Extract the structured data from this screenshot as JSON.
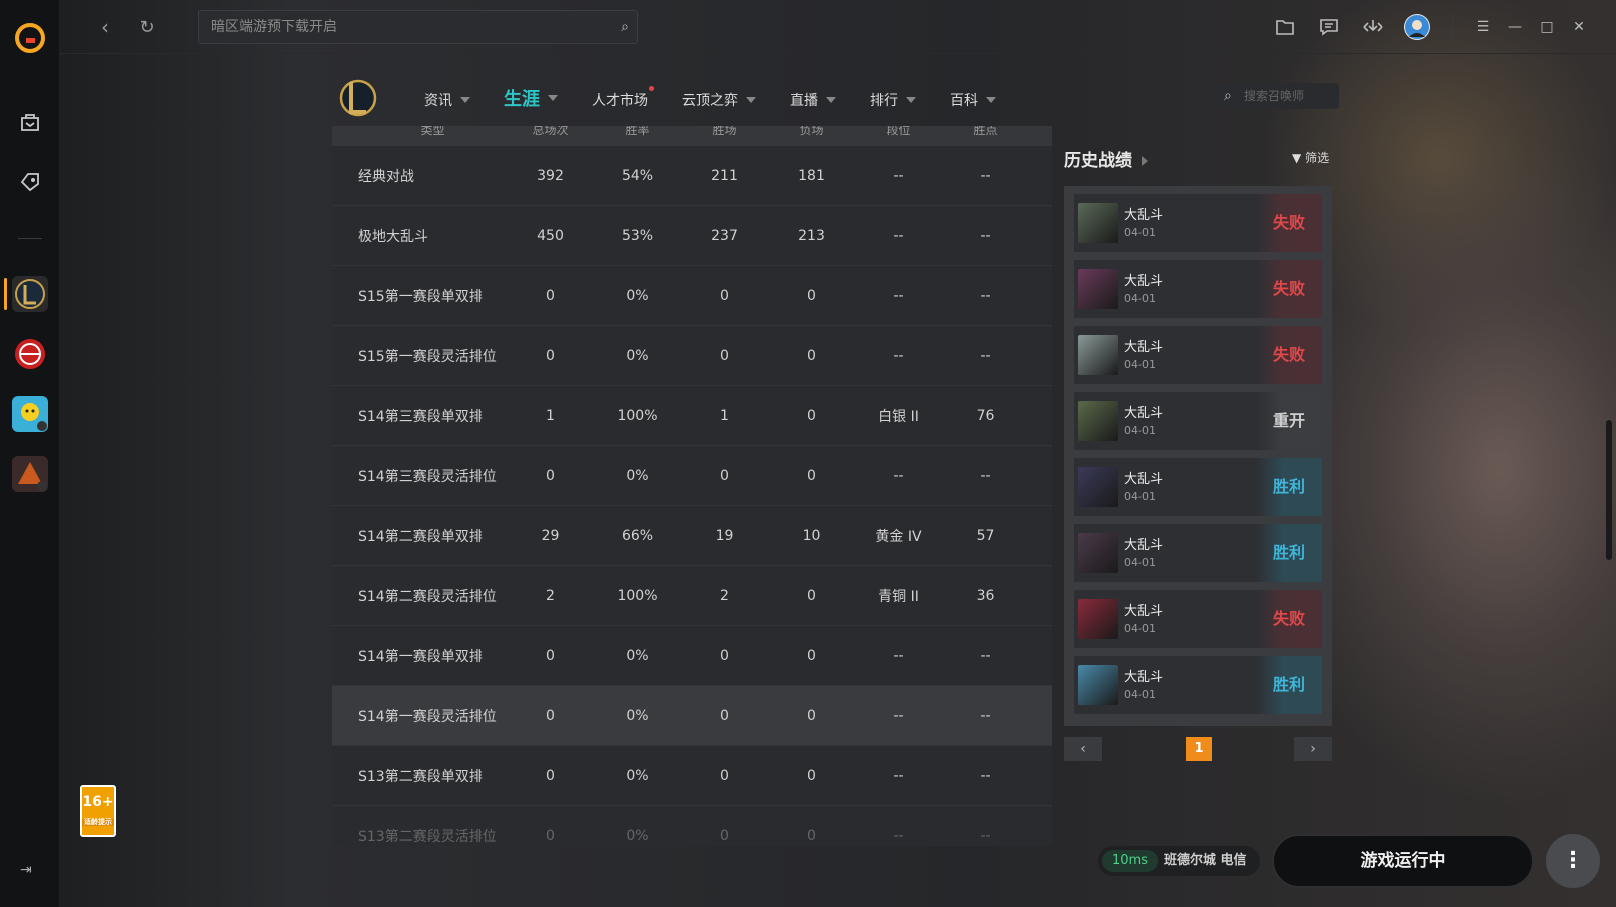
{
  "topbar": {
    "search_placeholder": "暗区端游预下载开启"
  },
  "subnav": {
    "tabs": [
      {
        "label": "资讯",
        "caret": true
      },
      {
        "label": "生涯",
        "caret": true,
        "active": true
      },
      {
        "label": "人才市场",
        "dot": true
      },
      {
        "label": "云顶之弈",
        "caret": true
      },
      {
        "label": "直播",
        "caret": true
      },
      {
        "label": "排行",
        "caret": true
      },
      {
        "label": "百科",
        "caret": true
      }
    ],
    "summoner_search_placeholder": "搜索召唤师"
  },
  "stats_table": {
    "headers": [
      "类型",
      "总场次",
      "胜率",
      "胜场",
      "负场",
      "段位",
      "胜点"
    ],
    "rows": [
      [
        "经典对战",
        "392",
        "54%",
        "211",
        "181",
        "--",
        "--"
      ],
      [
        "极地大乱斗",
        "450",
        "53%",
        "237",
        "213",
        "--",
        "--"
      ],
      [
        "S15第一赛段单双排",
        "0",
        "0%",
        "0",
        "0",
        "--",
        "--"
      ],
      [
        "S15第一赛段灵活排位",
        "0",
        "0%",
        "0",
        "0",
        "--",
        "--"
      ],
      [
        "S14第三赛段单双排",
        "1",
        "100%",
        "1",
        "0",
        "白银 II",
        "76"
      ],
      [
        "S14第三赛段灵活排位",
        "0",
        "0%",
        "0",
        "0",
        "--",
        "--"
      ],
      [
        "S14第二赛段单双排",
        "29",
        "66%",
        "19",
        "10",
        "黄金 IV",
        "57"
      ],
      [
        "S14第二赛段灵活排位",
        "2",
        "100%",
        "2",
        "0",
        "青铜 II",
        "36"
      ],
      [
        "S14第一赛段单双排",
        "0",
        "0%",
        "0",
        "0",
        "--",
        "--"
      ],
      [
        "S14第一赛段灵活排位",
        "0",
        "0%",
        "0",
        "0",
        "--",
        "--"
      ],
      [
        "S13第二赛段单双排",
        "0",
        "0%",
        "0",
        "0",
        "--",
        "--"
      ],
      [
        "S13第二赛段灵活排位",
        "0",
        "0%",
        "0",
        "0",
        "--",
        "--"
      ]
    ]
  },
  "history": {
    "title": "历史战绩",
    "filter_label": "筛选",
    "matches": [
      {
        "mode": "大乱斗",
        "date": "04-01",
        "result": "失败",
        "kind": "lose",
        "champ_color": "#5a6a58"
      },
      {
        "mode": "大乱斗",
        "date": "04-01",
        "result": "失败",
        "kind": "lose",
        "champ_color": "#6a3a5a"
      },
      {
        "mode": "大乱斗",
        "date": "04-01",
        "result": "失败",
        "kind": "lose",
        "champ_color": "#8a9a98"
      },
      {
        "mode": "大乱斗",
        "date": "04-01",
        "result": "重开",
        "kind": "remake",
        "champ_color": "#5a6a4a"
      },
      {
        "mode": "大乱斗",
        "date": "04-01",
        "result": "胜利",
        "kind": "win",
        "champ_color": "#3a3a5a"
      },
      {
        "mode": "大乱斗",
        "date": "04-01",
        "result": "胜利",
        "kind": "win",
        "champ_color": "#4a3a4a"
      },
      {
        "mode": "大乱斗",
        "date": "04-01",
        "result": "失败",
        "kind": "lose",
        "champ_color": "#8a2a3a"
      },
      {
        "mode": "大乱斗",
        "date": "04-01",
        "result": "胜利",
        "kind": "win",
        "champ_color": "#4a8aaa"
      }
    ],
    "page": "1"
  },
  "status": {
    "ping": "10ms",
    "server": "班德尔城 电信",
    "run_button": "游戏运行中",
    "age_rating": "16+",
    "age_caption": "适龄提示"
  },
  "colors": {
    "accent": "#2dc6c7",
    "lose": "#e0484a",
    "win": "#3fb5d8",
    "page_active": "#f08c1a"
  }
}
